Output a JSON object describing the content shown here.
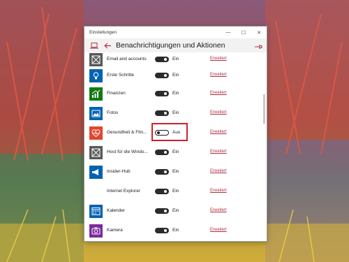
{
  "window": {
    "title": "Einstellungen",
    "minimize": "—",
    "maximize": "☐",
    "close": "✕"
  },
  "header": {
    "title": "Benachrichtigungen und Aktionen"
  },
  "apps": [
    {
      "name": "Email and accounts",
      "state": "Ein",
      "on": true,
      "link": "Erweitert",
      "icon": "gray-box-icon",
      "color": "#595959"
    },
    {
      "name": "Erste Schritte",
      "state": "Ein",
      "on": true,
      "link": "Erweitert",
      "icon": "lightbulb-icon",
      "color": "#0063b1"
    },
    {
      "name": "Finanzen",
      "state": "Ein",
      "on": true,
      "link": "Erweitert",
      "icon": "chart-icon",
      "color": "#107c10"
    },
    {
      "name": "Fotos",
      "state": "Ein",
      "on": true,
      "link": "Erweitert",
      "icon": "photo-icon",
      "color": "#0063b1"
    },
    {
      "name": "Gesundheit & Fitn...",
      "state": "Aus",
      "on": false,
      "link": "Erweitert",
      "icon": "heart-icon",
      "color": "#e3452d"
    },
    {
      "name": "Host für die Windo...",
      "state": "Ein",
      "on": true,
      "link": "Erweitert",
      "icon": "gray-box-icon",
      "color": "#595959"
    },
    {
      "name": "Insider-Hub",
      "state": "Ein",
      "on": true,
      "link": "Erweitert",
      "icon": "megaphone-icon",
      "color": "#0063b1"
    },
    {
      "name": "Internet Explorer",
      "state": "Ein",
      "on": true,
      "link": "Erweitert",
      "icon": "blank-icon",
      "color": "#ffffff"
    },
    {
      "name": "Kalender",
      "state": "Ein",
      "on": true,
      "link": "Erweitert",
      "icon": "calendar-icon",
      "color": "#0063b1"
    },
    {
      "name": "Kamera",
      "state": "Ein",
      "on": true,
      "link": "Erweitert",
      "icon": "camera-icon",
      "color": "#7a2c9c"
    }
  ]
}
